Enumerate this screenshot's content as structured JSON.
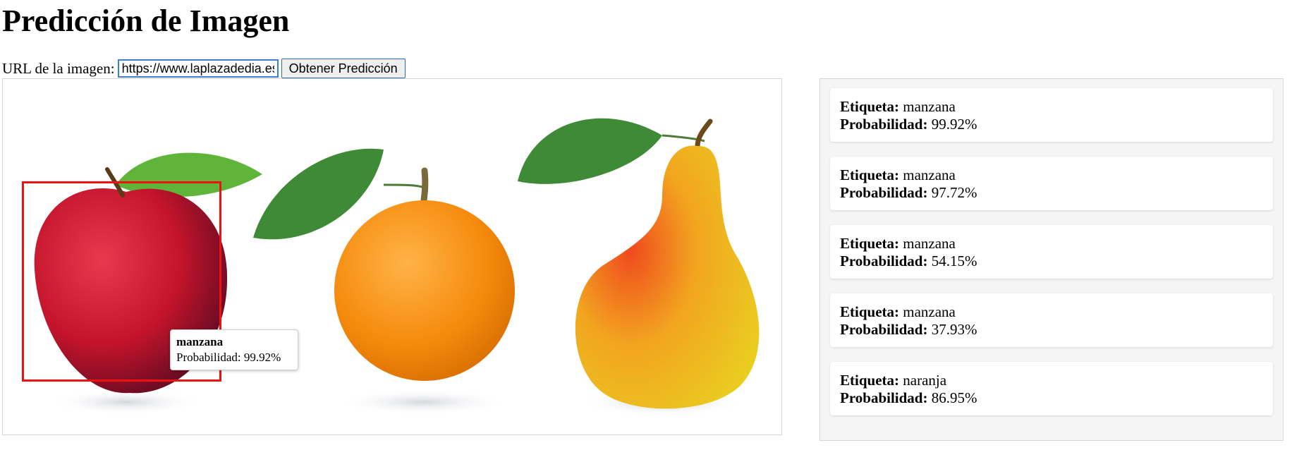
{
  "page": {
    "title": "Predicción de Imagen"
  },
  "form": {
    "url_label": "URL de la imagen:",
    "url_value": "https://www.laplazadedia.es",
    "button_label": "Obtener Predicción"
  },
  "detection_tooltip": {
    "label": "manzana",
    "probability_text": "Probabilidad: 99.92%"
  },
  "results_labels": {
    "tag": "Etiqueta:",
    "prob": "Probabilidad:"
  },
  "results": [
    {
      "label": "manzana",
      "probability": "99.92%"
    },
    {
      "label": "manzana",
      "probability": "97.72%"
    },
    {
      "label": "manzana",
      "probability": "54.15%"
    },
    {
      "label": "manzana",
      "probability": "37.93%"
    },
    {
      "label": "naranja",
      "probability": "86.95%"
    }
  ],
  "colors": {
    "bbox": "#ee1111",
    "apple": "#c3142b",
    "orange": "#f58a0c",
    "pear": "#f2c21e",
    "leaf": "#3f8a36"
  }
}
